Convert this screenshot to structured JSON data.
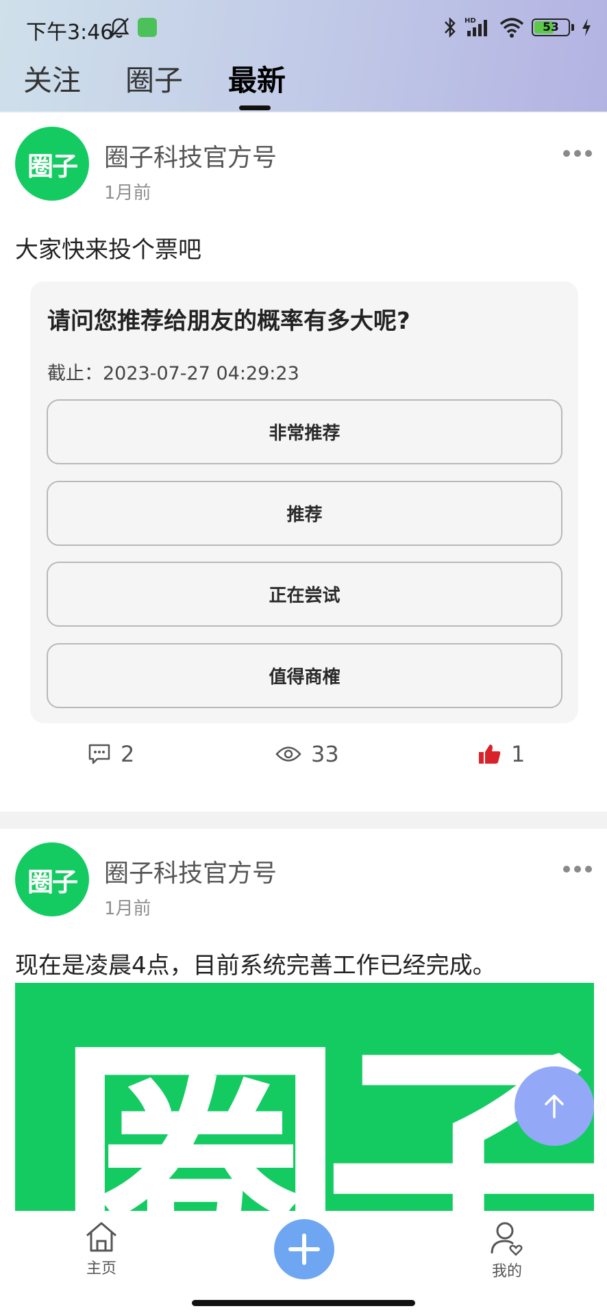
{
  "status_bar": {
    "time": "下午3:46",
    "battery": "53",
    "icons": [
      "bell-off-icon",
      "app-badge-icon",
      "bluetooth-icon",
      "hd-signal-icon",
      "wifi-icon",
      "battery-icon",
      "charging-icon"
    ]
  },
  "tabs": [
    {
      "label": "关注",
      "active": false
    },
    {
      "label": "圈子",
      "active": false
    },
    {
      "label": "最新",
      "active": true
    }
  ],
  "posts": [
    {
      "avatar_text": "圈子",
      "author": "圈子科技官方号",
      "time": "1月前",
      "text": "大家快来投个票吧",
      "poll": {
        "question": "请问您推荐给朋友的概率有多大呢?",
        "deadline": "截止：2023-07-27 04:29:23",
        "options": [
          "非常推荐",
          "推荐",
          "正在尝试",
          "值得商榷"
        ]
      },
      "stats": {
        "comments": "2",
        "views": "33",
        "likes": "1"
      }
    },
    {
      "avatar_text": "圈子",
      "author": "圈子科技官方号",
      "time": "1月前",
      "text": "现在是凌晨4点，目前系统完善工作已经完成。",
      "image_text": "圈子"
    }
  ],
  "bottom_nav": {
    "home": "主页",
    "me": "我的"
  },
  "colors": {
    "brand_green": "#14cb62",
    "like_red": "#d8232a",
    "scroll_top_blue": "#93a9f7",
    "add_button_blue": "#6ea6f2"
  }
}
